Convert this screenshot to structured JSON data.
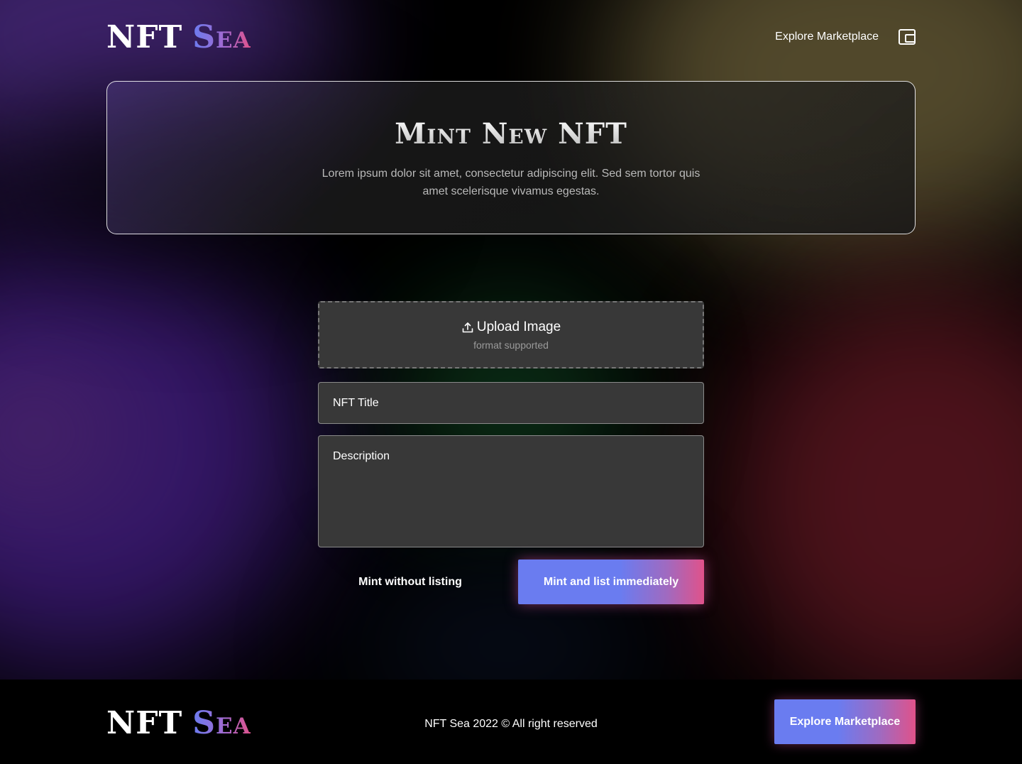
{
  "brand": {
    "name_primary": "NFT",
    "name_secondary": "Sea"
  },
  "header": {
    "nav_link": "Explore Marketplace",
    "wallet_icon": "wallet-icon"
  },
  "hero": {
    "title": "Mint New NFT",
    "subtitle": "Lorem ipsum dolor sit amet, consectetur adipiscing elit. Sed sem tortor quis amet scelerisque vivamus egestas."
  },
  "form": {
    "upload": {
      "icon": "upload-icon",
      "label": "Upload Image",
      "hint": "format supported"
    },
    "title_placeholder": "NFT Title",
    "description_placeholder": "Description",
    "mint_only_label": "Mint without listing",
    "mint_list_label": "Mint and list immediately"
  },
  "footer": {
    "copyright": "NFT Sea 2022 © All right reserved",
    "cta_label": "Explore Marketplace"
  },
  "colors": {
    "gradient_start": "#6a7cf0",
    "gradient_end": "#e0528a",
    "field_bg": "#383838",
    "page_bg": "#000000"
  }
}
